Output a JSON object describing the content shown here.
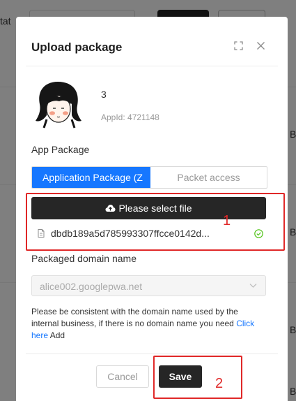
{
  "background": {
    "stat_fragment": "tat",
    "edge_fragments": [
      "B",
      "B",
      "B",
      "B"
    ]
  },
  "modal": {
    "title": "Upload package",
    "app": {
      "name": "3",
      "app_id": "AppId: 4721148"
    },
    "app_package_label": "App Package",
    "tabs": [
      {
        "label": "Application Package (Z",
        "active": true
      },
      {
        "label": "Packet access",
        "active": false
      }
    ],
    "select_file_label": "Please select file",
    "file": {
      "name": "dbdb189a5d785993307ffcce0142d...",
      "status_icon": "check-circle-icon"
    },
    "domain_label": "Packaged domain name",
    "domain_value": "alice002.googlepwa.net",
    "help": {
      "text": "Please be consistent with the domain name used by the internal business, if there is no domain name you need ",
      "link": "Click here",
      "suffix": " Add"
    },
    "cancel_label": "Cancel",
    "save_label": "Save"
  },
  "annotations": {
    "box1_number": "1",
    "box2_number": "2",
    "color": "#e02828"
  },
  "colors": {
    "primary": "#1677ff",
    "dark_button": "#262626",
    "success": "#52c41a"
  }
}
